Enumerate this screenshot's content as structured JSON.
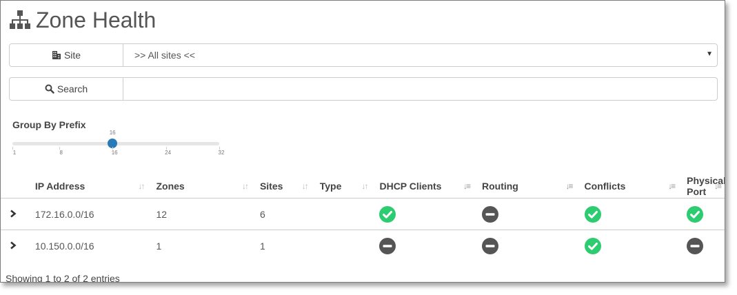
{
  "page": {
    "title": "Zone Health",
    "title_icon": "sitemap-icon"
  },
  "filters": {
    "site_label": "Site",
    "site_icon": "building-icon",
    "site_value": ">> All sites <<",
    "search_label": "Search",
    "search_icon": "search-icon",
    "search_value": ""
  },
  "group_by": {
    "label": "Group By Prefix",
    "value": 16,
    "value_label": "16",
    "min": 1,
    "max": 32,
    "ticks": [
      "1",
      "8",
      "16",
      "24",
      "32"
    ]
  },
  "table": {
    "columns": [
      "IP Address",
      "Zones",
      "Sites",
      "Type",
      "DHCP Clients",
      "Routing",
      "Conflicts",
      "Physical Port"
    ],
    "rows": [
      {
        "ip": "172.16.0.0/16",
        "zones": "12",
        "sites": "6",
        "type": "",
        "dhcp": "ok",
        "routing": "none",
        "conflicts": "ok",
        "physical_port": "ok"
      },
      {
        "ip": "10.150.0.0/16",
        "zones": "1",
        "sites": "1",
        "type": "",
        "dhcp": "none",
        "routing": "none",
        "conflicts": "ok",
        "physical_port": "none"
      }
    ]
  },
  "footer": {
    "info": "Showing 1 to 2 of 2 entries"
  },
  "colors": {
    "ok": "#2ecc71",
    "none": "#555555",
    "accent": "#2a7ab8"
  }
}
